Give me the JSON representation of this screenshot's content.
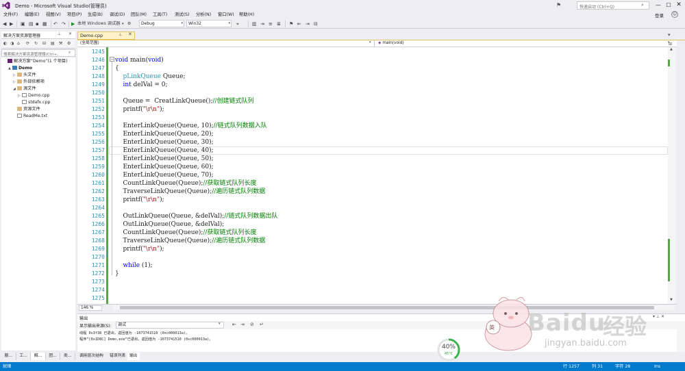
{
  "window": {
    "title": "Demo - Microsoft Visual Studio(管理员)",
    "quick_launch_placeholder": "快速启动 (Ctrl+Q)",
    "login": "登录"
  },
  "menu": [
    "文件(F)",
    "编辑(E)",
    "视图(V)",
    "项目(P)",
    "生成(B)",
    "调试(D)",
    "团队(M)",
    "工具(T)",
    "测试(S)",
    "分析(N)",
    "窗口(W)",
    "帮助(H)"
  ],
  "toolbar": {
    "run_label": "本地 Windows 调试器",
    "config": "Debug",
    "platform": "Win32"
  },
  "solution_explorer": {
    "title": "解决方案资源管理器",
    "search_placeholder": "搜索解决方案资源管理器(Ctrl+;",
    "tree": [
      {
        "label": "解决方案“Demo”(1 个项目)",
        "icon": "solution-icon",
        "indent": 0,
        "arrow": ""
      },
      {
        "label": "Demo",
        "icon": "project-icon",
        "indent": 1,
        "arrow": "▲",
        "bold": true
      },
      {
        "label": "头文件",
        "icon": "folder-icon",
        "indent": 2,
        "arrow": "▷"
      },
      {
        "label": "外部依赖项",
        "icon": "folder-icon",
        "indent": 2,
        "arrow": "▷"
      },
      {
        "label": "源文件",
        "icon": "folder-icon",
        "indent": 2,
        "arrow": "◢"
      },
      {
        "label": "Demo.cpp",
        "icon": "cpp-file-icon",
        "indent": 3,
        "arrow": "▷"
      },
      {
        "label": "stdafx.cpp",
        "icon": "cpp-file-icon",
        "indent": 3,
        "arrow": ""
      },
      {
        "label": "资源文件",
        "icon": "folder-icon",
        "indent": 2,
        "arrow": ""
      },
      {
        "label": "ReadMe.txt",
        "icon": "txt-file-icon",
        "indent": 2,
        "arrow": ""
      }
    ],
    "tabs": [
      "服...",
      "工...",
      "解...",
      "团...",
      "类..."
    ]
  },
  "editor": {
    "tab_label": "Demo.cpp",
    "nav_scope": "(全局范围)",
    "nav_member": "main(void)",
    "zoom": "146 %",
    "current_line_index": 12,
    "first_line_number": 1245,
    "lines": [
      [],
      [
        {
          "t": "void",
          "c": "kw"
        },
        {
          "t": " main(",
          "c": "fn"
        },
        {
          "t": "void",
          "c": "kw"
        },
        {
          "t": ")",
          "c": "fn"
        }
      ],
      [
        {
          "t": "{",
          "c": "fn"
        }
      ],
      [
        {
          "t": "    ",
          "c": "fn"
        },
        {
          "t": "pLinkQueue",
          "c": "ty"
        },
        {
          "t": " Queue;",
          "c": "fn"
        }
      ],
      [
        {
          "t": "    ",
          "c": "fn"
        },
        {
          "t": "int",
          "c": "kw"
        },
        {
          "t": " delVal = 0;",
          "c": "fn"
        }
      ],
      [],
      [
        {
          "t": "    Queue =  CreatLinkQueue();",
          "c": "fn"
        },
        {
          "t": "//创建链式队列",
          "c": "cm"
        }
      ],
      [
        {
          "t": "    printf(",
          "c": "fn"
        },
        {
          "t": "\"\\r\\n\"",
          "c": "st"
        },
        {
          "t": ");",
          "c": "fn"
        }
      ],
      [],
      [
        {
          "t": "    EnterLinkQueue(Queue, 10);",
          "c": "fn"
        },
        {
          "t": "//链式队列数据入队",
          "c": "cm"
        }
      ],
      [
        {
          "t": "    EnterLinkQueue(Queue, 20);",
          "c": "fn"
        }
      ],
      [
        {
          "t": "    EnterLinkQueue(Queue, 30);",
          "c": "fn"
        }
      ],
      [
        {
          "t": "    EnterLinkQueue(Queue, 40);",
          "c": "fn"
        }
      ],
      [
        {
          "t": "    EnterLinkQueue(Queue, 50);",
          "c": "fn"
        }
      ],
      [
        {
          "t": "    EnterLinkQueue(Queue, 60);",
          "c": "fn"
        }
      ],
      [
        {
          "t": "    EnterLinkQueue(Queue, 70);",
          "c": "fn"
        }
      ],
      [
        {
          "t": "    CountLinkQueue(Queue);",
          "c": "fn"
        },
        {
          "t": "//获取链式队列长度",
          "c": "cm"
        }
      ],
      [
        {
          "t": "    TraverseLinkQueue(Queue);",
          "c": "fn"
        },
        {
          "t": "//遍历链式队列数据",
          "c": "cm"
        }
      ],
      [
        {
          "t": "    printf(",
          "c": "fn"
        },
        {
          "t": "\"\\r\\n\"",
          "c": "st"
        },
        {
          "t": ");",
          "c": "fn"
        }
      ],
      [],
      [
        {
          "t": "    OutLinkQueue(Queue, &delVal);",
          "c": "fn"
        },
        {
          "t": "//链式队列数据出队",
          "c": "cm"
        }
      ],
      [
        {
          "t": "    OutLinkQueue(Queue, &delVal);",
          "c": "fn"
        }
      ],
      [
        {
          "t": "    CountLinkQueue(Queue);",
          "c": "fn"
        },
        {
          "t": "//获取链式队列长度",
          "c": "cm"
        }
      ],
      [
        {
          "t": "    TraverseLinkQueue(Queue);",
          "c": "fn"
        },
        {
          "t": "//遍历链式队列数据",
          "c": "cm"
        }
      ],
      [
        {
          "t": "    printf(",
          "c": "fn"
        },
        {
          "t": "\"\\r\\n\"",
          "c": "st"
        },
        {
          "t": ");",
          "c": "fn"
        }
      ],
      [],
      [
        {
          "t": "    ",
          "c": "fn"
        },
        {
          "t": "while",
          "c": "kw"
        },
        {
          "t": " (1);",
          "c": "fn"
        }
      ],
      [
        {
          "t": "}",
          "c": "fn"
        }
      ],
      [],
      [],
      []
    ]
  },
  "output": {
    "title": "输出",
    "source_label": "显示输出来源(S):",
    "source_value": "调试",
    "lines": [
      "线程 0x3f38 已退出，返回值为 -1073741510 (0xc000013a)。",
      "程序“[0x1D8C] Demo.exe”已退出，返回值为 -1073741510 (0xc000013a)。"
    ],
    "tabs": [
      "调用层次结构",
      "错误列表",
      "输出"
    ]
  },
  "statusbar": {
    "ready": "就绪",
    "line": "行 1257",
    "col": "列 31",
    "char": "字符 28",
    "mode": "Ins"
  },
  "overlay": {
    "gauge_value": "40%",
    "gauge_fraction": 0.4,
    "gauge_temp": "45°C",
    "watermark_brand": "Baidu",
    "watermark_suffix": "经验",
    "watermark_url": "jingyan.baidu.com",
    "mascot_char": "英"
  },
  "colors": {
    "accent": "#007acc",
    "tab_active": "#fff2c8",
    "keyword": "#0000ff",
    "type": "#2b91af",
    "comment": "#008000",
    "string": "#a31515",
    "change_bar": "#57a64a"
  }
}
